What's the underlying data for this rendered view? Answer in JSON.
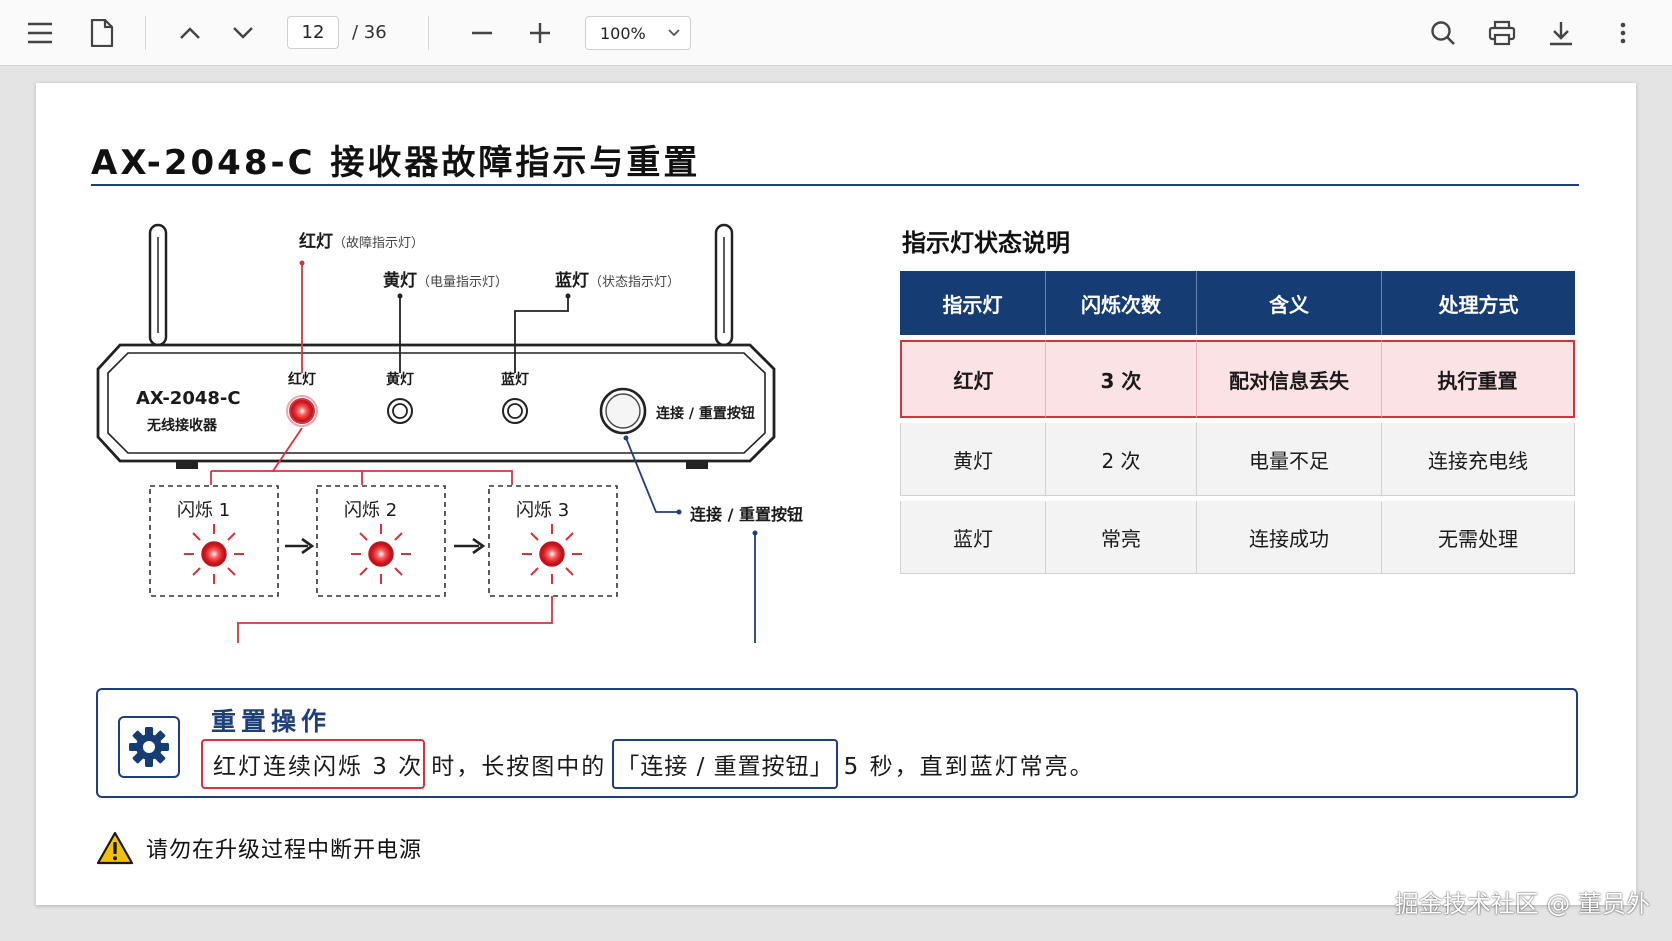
{
  "toolbar": {
    "current_page": "12",
    "total_pages": "/ 36",
    "zoom": "100%",
    "icons": [
      "menu-icon",
      "document-icon",
      "chevron-up-icon",
      "chevron-down-icon",
      "minus-icon",
      "plus-icon",
      "search-icon",
      "print-icon",
      "download-icon",
      "more-vertical-icon"
    ]
  },
  "document": {
    "title": "AX-2048-C 接收器故障指示与重置",
    "device": {
      "model": "AX-2048-C",
      "subtitle": "无线接收器",
      "led_red_label": "红灯",
      "led_yellow_label": "黄灯",
      "led_blue_label": "蓝灯",
      "button_label": "连接 / 重置按钮"
    },
    "callouts": {
      "red": "红灯",
      "red_note": "（故障指示灯）",
      "yellow": "黄灯",
      "yellow_note": "（电量指示灯）",
      "blue": "蓝灯",
      "blue_note": "（状态指示灯）",
      "button": "连接 / 重置按钮"
    },
    "flash_steps": [
      "闪烁 1",
      "闪烁 2",
      "闪烁 3"
    ],
    "table": {
      "heading": "指示灯状态说明",
      "headers": [
        "指示灯",
        "闪烁次数",
        "含义",
        "处理方式"
      ],
      "rows": [
        [
          "红灯",
          "3 次",
          "配对信息丢失",
          "执行重置"
        ],
        [
          "黄灯",
          "2 次",
          "电量不足",
          "连接充电线"
        ],
        [
          "蓝灯",
          "常亮",
          "连接成功",
          "无需处理"
        ]
      ]
    },
    "reset": {
      "title": "重置操作",
      "part1": "红灯连续闪烁 3 次",
      "part2": "时，长按图中的",
      "part3": "「连接 / 重置按钮」",
      "part4": "5 秒，直到蓝灯常亮。"
    },
    "warning": "请勿在升级过程中断开电源"
  },
  "watermark": "掘金技术社区 @ 董员外",
  "colors": {
    "accent_blue": "#153c73",
    "alert_red": "#d6333f",
    "highlight_red_bg": "#fbe2e4",
    "warning_yellow": "#f2c200"
  }
}
